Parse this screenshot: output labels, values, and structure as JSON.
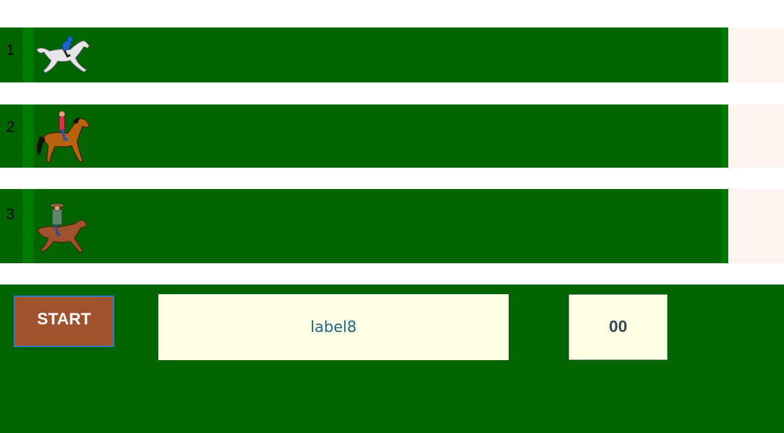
{
  "lanes": [
    {
      "number": "1",
      "horse_icon": "grey-horse-blue-jockey-icon"
    },
    {
      "number": "2",
      "horse_icon": "brown-horse-red-rider-icon"
    },
    {
      "number": "3",
      "horse_icon": "brown-horse-cowboy-rider-icon"
    }
  ],
  "controls": {
    "start_label": "START",
    "result_label": "label8",
    "counter_value": "00"
  },
  "colors": {
    "track": "#006400",
    "finish_area": "#fdf4ef",
    "start_button": "#a0522d",
    "label_background": "#ffffe6"
  }
}
